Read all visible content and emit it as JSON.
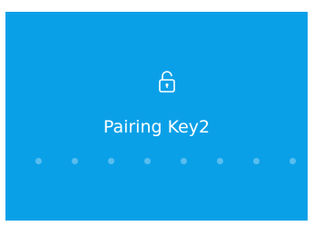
{
  "screen": {
    "background_color": "#0aa0e8",
    "icon": "lock-icon",
    "title": "Pairing Key2",
    "pin_length": 8,
    "pin_entered": 0,
    "dot_empty_color": "#58bdef",
    "dot_filled_color": "#ffffff"
  }
}
